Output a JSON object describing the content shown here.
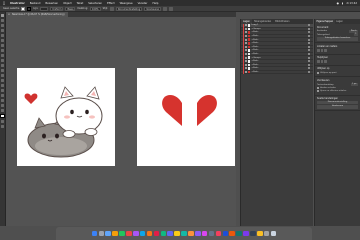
{
  "menubar": {
    "app": "Illustrator",
    "items": [
      "Bestand",
      "Bewerken",
      "Object",
      "Tekst",
      "Selecteren",
      "Effect",
      "Weergave",
      "Venster",
      "Help"
    ],
    "clock": "di 13:42"
  },
  "controlbar": {
    "selection_label": "Geen selectie",
    "stroke_label": "Lijn:",
    "uniform_label": "Uniform",
    "style_label": "Basis",
    "opacity_label": "Dekking:",
    "opacity_value": "100%",
    "style2_label": "Stijl:",
    "doc_setup_label": "Documentinstelling",
    "prefs_label": "Voorkeuren",
    "doc_title": "Adobe Illustrator 2024",
    "fill_color": "#ffffff",
    "stroke_color": "#000000"
  },
  "document": {
    "tab_label": "Naamloos-1* @ 66,67 % (RGB/Voorvertoning)"
  },
  "layers_panel": {
    "tabs": [
      "Lagen",
      "Tekengebieden",
      "Bibliotheken"
    ],
    "rows": [
      {
        "name": "Laag 1",
        "thumb": "white",
        "highlight": true
      },
      {
        "name": "<Groep>",
        "thumb": "white",
        "highlight": false
      },
      {
        "name": "<Pad>",
        "thumb": "red",
        "highlight": false
      },
      {
        "name": "<Pad>",
        "thumb": "red",
        "highlight": false
      },
      {
        "name": "<Pad>",
        "thumb": "red",
        "highlight": false
      },
      {
        "name": "<Pad>",
        "thumb": "red",
        "highlight": false
      },
      {
        "name": "<Pad>",
        "thumb": "red",
        "highlight": false
      },
      {
        "name": "<Pad>",
        "thumb": "white",
        "highlight": false
      },
      {
        "name": "<Pad>",
        "thumb": "white",
        "highlight": false
      },
      {
        "name": "<Groep>",
        "thumb": "white",
        "highlight": false
      },
      {
        "name": "<Pad>",
        "thumb": "white",
        "highlight": false
      },
      {
        "name": "<Pad>",
        "thumb": "white",
        "highlight": false
      },
      {
        "name": "<Pad>",
        "thumb": "white",
        "highlight": false
      },
      {
        "name": "<Pad>",
        "thumb": "red",
        "highlight": false
      }
    ]
  },
  "props_panel": {
    "tabs": [
      "Eigenschappen",
      "Lagen"
    ],
    "section1_title": "Document",
    "units_label": "Eenheden",
    "units_value": "Pixels",
    "artboard_label": "Tekengebied",
    "artboard_value": "1",
    "edit_artboards": "Tekengebieden bewerken",
    "section2_title": "Linialen en rasters",
    "section3_title": "Hulplijnen",
    "section4_title": "Uitlijnen op",
    "snap_label": "Uitlijnen op punt",
    "section5_title": "Voorkeuren",
    "keyboard_increment_label": "Toetsenbordstap",
    "keyboard_increment_value": "1 px",
    "check1": "Hoeken schalen",
    "check2": "Lijnen en effecten schalen",
    "section6_title": "Snelle handelingen",
    "btn1": "Documentinstelling",
    "btn2": "Voorkeuren"
  },
  "dock": {
    "colors": [
      "#3b82f6",
      "#9ca3af",
      "#60a5fa",
      "#f59e0b",
      "#22c55e",
      "#ef4444",
      "#a855f7",
      "#0ea5e9",
      "#f97316",
      "#e11d48",
      "#10b981",
      "#6366f1",
      "#facc15",
      "#14b8a6",
      "#fb923c",
      "#8b5cf6",
      "#d946ef",
      "#64748b",
      "#f43f5e",
      "#1d4ed8",
      "#ea580c",
      "#0f766e",
      "#7c3aed",
      "#334155",
      "#fbbf24",
      "#a3a3a3",
      "#cbd5e1"
    ]
  }
}
